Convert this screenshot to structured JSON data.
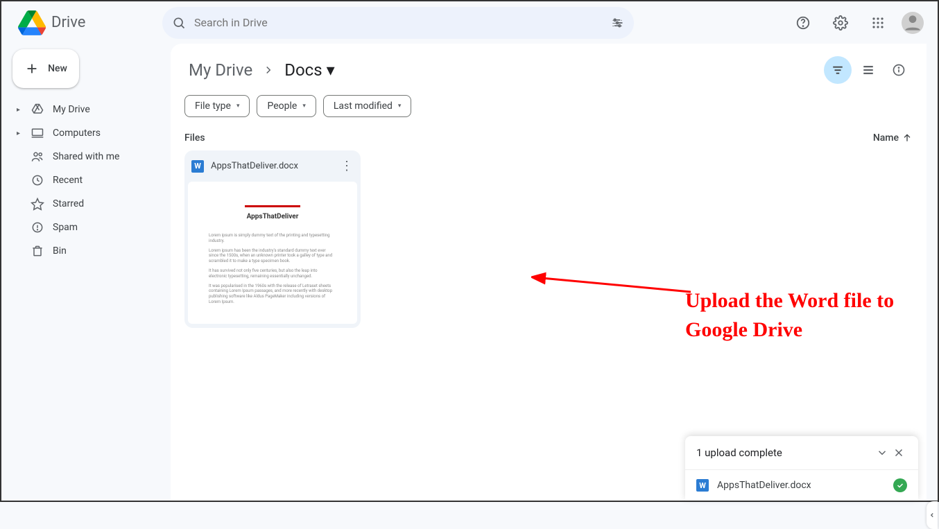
{
  "header": {
    "product": "Drive",
    "search_placeholder": "Search in Drive"
  },
  "sidebar": {
    "new_label": "New",
    "items": [
      {
        "label": "My Drive",
        "icon": "mydrive",
        "caret": true
      },
      {
        "label": "Computers",
        "icon": "computers",
        "caret": true
      },
      {
        "label": "Shared with me",
        "icon": "shared",
        "caret": false
      },
      {
        "label": "Recent",
        "icon": "recent",
        "caret": false
      },
      {
        "label": "Starred",
        "icon": "star",
        "caret": false
      },
      {
        "label": "Spam",
        "icon": "spam",
        "caret": false
      },
      {
        "label": "Bin",
        "icon": "bin",
        "caret": false
      }
    ]
  },
  "breadcrumb": {
    "parent": "My Drive",
    "current": "Docs"
  },
  "chips": {
    "file_type": "File type",
    "people": "People",
    "last_modified": "Last modified"
  },
  "content": {
    "section_label": "Files",
    "sort_label": "Name"
  },
  "files": [
    {
      "name": "AppsThatDeliver.docx",
      "preview_title": "AppsThatDeliver"
    }
  ],
  "upload_toast": {
    "title": "1 upload complete",
    "item_name": "AppsThatDeliver.docx"
  },
  "annotation": {
    "text": "Upload the Word file to Google Drive"
  }
}
